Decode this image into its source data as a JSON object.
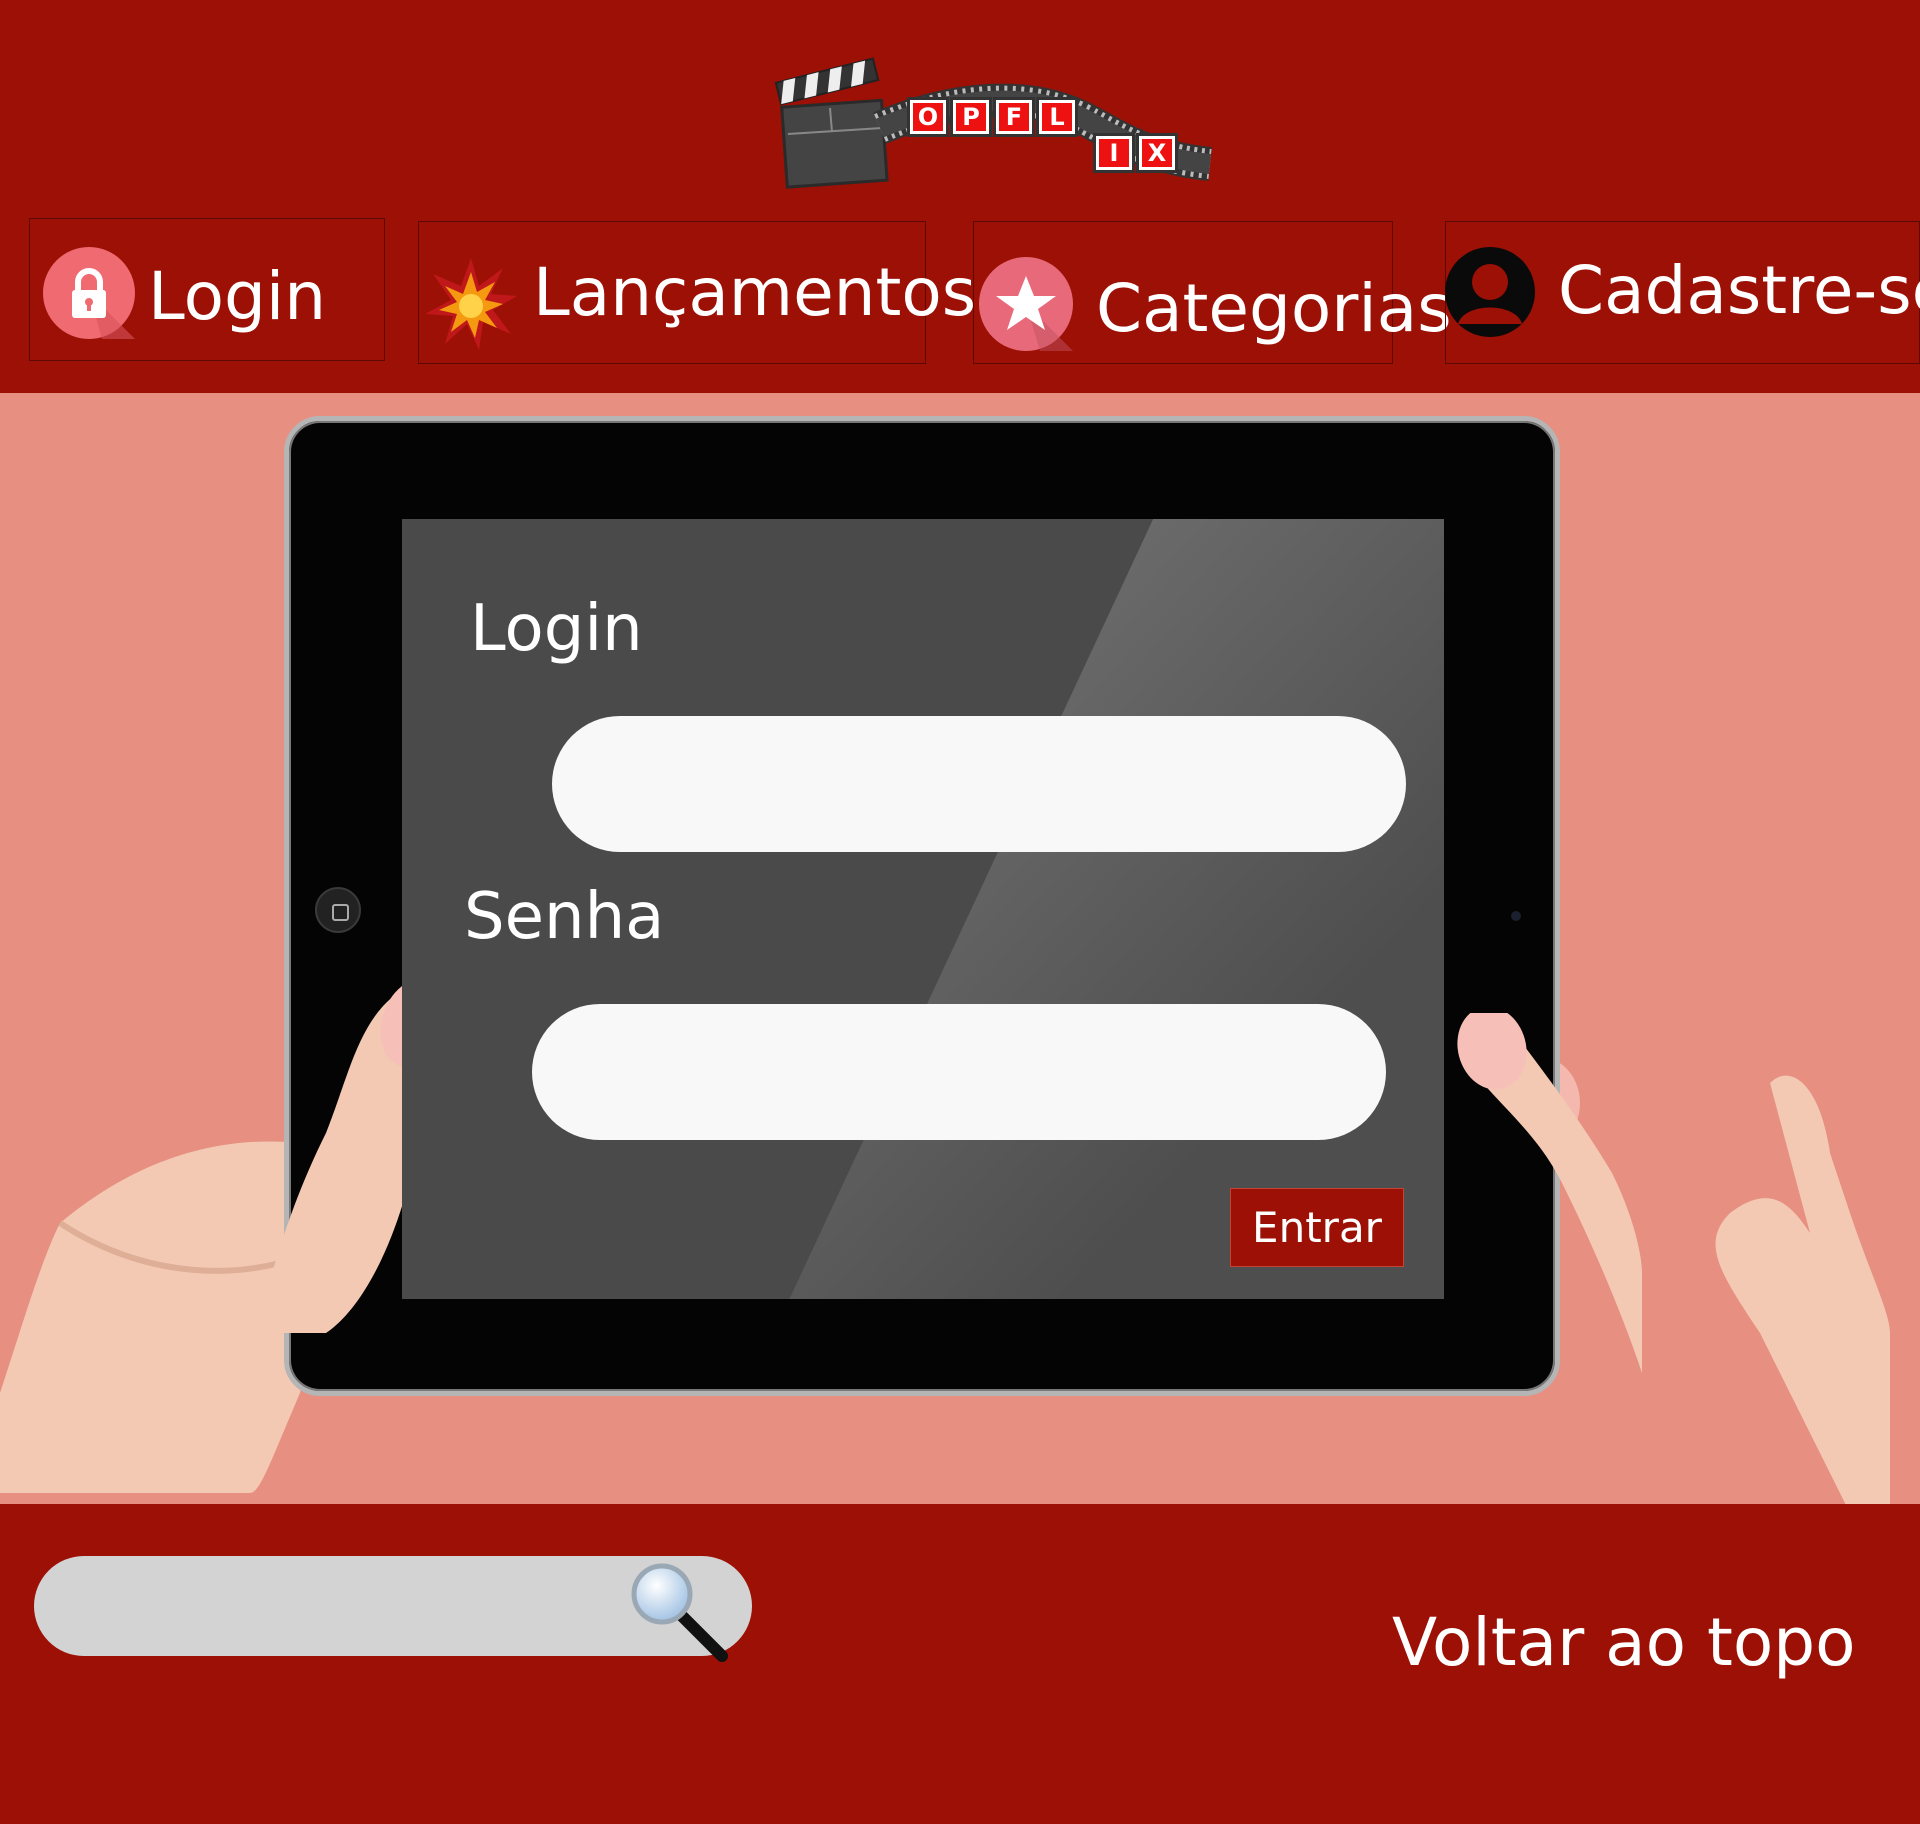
{
  "header": {
    "logo": {
      "name": "OPFLIX",
      "letters_top": [
        "O",
        "P",
        "F",
        "L"
      ],
      "letters_bottom": [
        "I",
        "X"
      ]
    },
    "nav": [
      {
        "label": "Login",
        "icon": "lock-icon"
      },
      {
        "label": "Lançamentos",
        "icon": "explosion-icon"
      },
      {
        "label": "Categorias",
        "icon": "star-icon"
      },
      {
        "label": "Cadastre-se",
        "icon": "user-icon"
      }
    ]
  },
  "login_form": {
    "login_label": "Login",
    "login_value": "",
    "password_label": "Senha",
    "password_value": "",
    "submit_label": "Entrar"
  },
  "footer": {
    "search_value": "",
    "search_icon": "magnifier-icon",
    "back_to_top": "Voltar ao topo"
  },
  "colors": {
    "brand_red": "#9c1006",
    "background_salmon": "#e78f80",
    "screen_gray": "#4a4a4a",
    "input_white": "#f8f8f8",
    "search_gray": "#d3d3d3"
  }
}
